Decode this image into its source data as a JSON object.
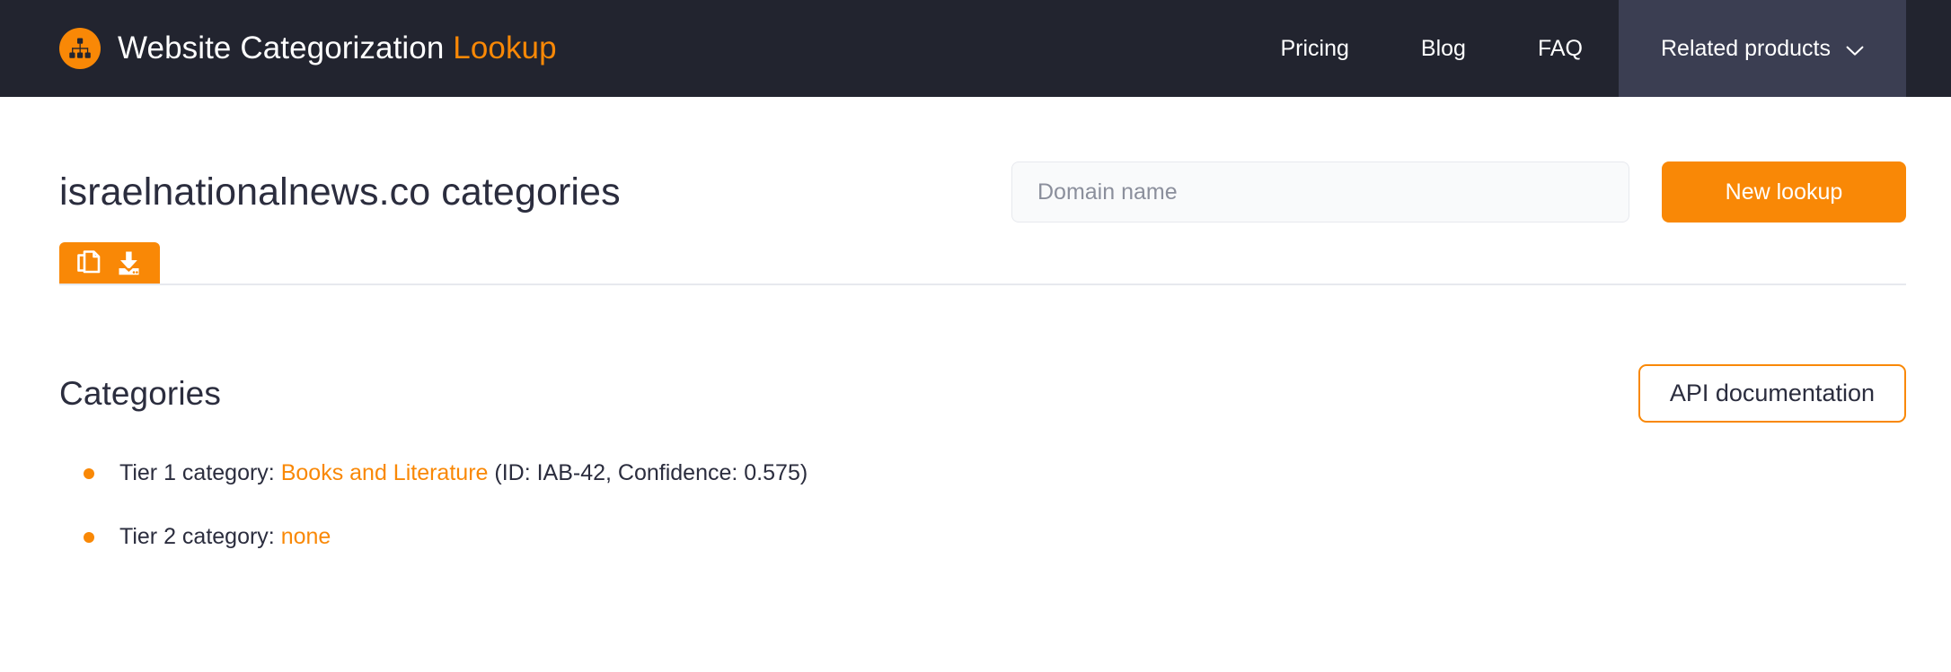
{
  "header": {
    "logo_icon": "sitemap-icon",
    "brand_name": "Website Categorization",
    "brand_accent": "Lookup",
    "nav": [
      {
        "label": "Pricing"
      },
      {
        "label": "Blog"
      },
      {
        "label": "FAQ"
      }
    ],
    "dropdown": {
      "label": "Related products",
      "icon": "chevron-down-icon"
    }
  },
  "main": {
    "page_title": "israelnationalnews.co categories",
    "search": {
      "placeholder": "Domain name",
      "value": "",
      "submit_label": "New lookup"
    },
    "actions": {
      "copy_icon": "copy-icon",
      "download_icon": "download-icon"
    },
    "section": {
      "title": "Categories",
      "api_doc_label": "API documentation"
    },
    "categories": [
      {
        "label": "Tier 1 category:",
        "value": "Books and Literature",
        "value_is_link": true,
        "meta": "(ID: IAB-42, Confidence: 0.575)"
      },
      {
        "label": "Tier 2 category:",
        "value": "none",
        "value_is_link": false,
        "meta": ""
      }
    ]
  },
  "colors": {
    "accent": "#f98806",
    "header_bg": "#22242f",
    "header_highlight": "#3b3e52",
    "text_dark": "#2b2d3e",
    "rule": "#e7e9ee"
  }
}
